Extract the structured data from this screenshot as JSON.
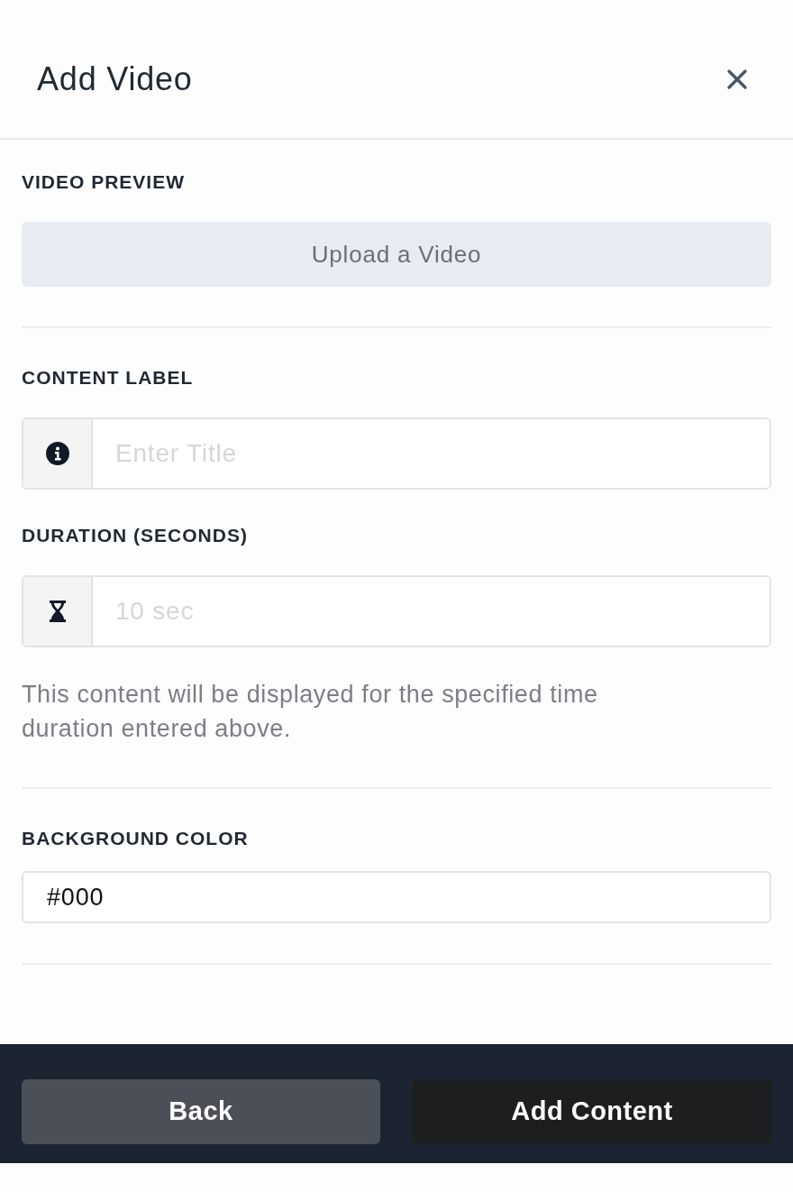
{
  "header": {
    "title": "Add Video"
  },
  "sections": [
    {
      "fields": [
        {
          "kind": "upload",
          "label": "VIDEO PREVIEW",
          "button": "Upload a Video"
        }
      ]
    },
    {
      "fields": [
        {
          "kind": "text",
          "label": "CONTENT LABEL",
          "placeholder": "Enter Title"
        },
        {
          "kind": "duration",
          "label": "DURATION (SECONDS)",
          "placeholder": "10 sec",
          "help": "This content will be displayed for the specified time duration entered above."
        }
      ]
    },
    {
      "fields": [
        {
          "kind": "color",
          "label": "BACKGROUND COLOR",
          "value": "#000"
        }
      ]
    }
  ],
  "footer": {
    "buttons": [
      {
        "kind": "secondary",
        "label": "Back"
      },
      {
        "kind": "primary",
        "label": "Add Content"
      }
    ]
  }
}
